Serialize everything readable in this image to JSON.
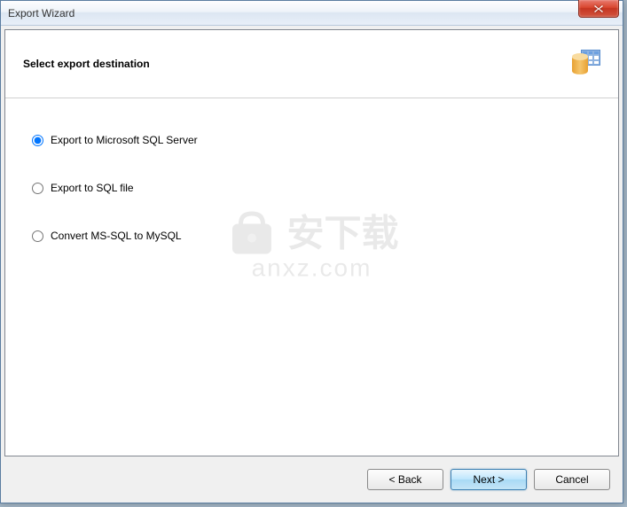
{
  "window": {
    "title": "Export Wizard"
  },
  "header": {
    "title": "Select export destination"
  },
  "options": [
    {
      "label": "Export to Microsoft SQL Server",
      "selected": true
    },
    {
      "label": "Export to SQL file",
      "selected": false
    },
    {
      "label": "Convert MS-SQL to MySQL",
      "selected": false
    }
  ],
  "buttons": {
    "back": "< Back",
    "next": "Next >",
    "cancel": "Cancel"
  },
  "watermark": {
    "text_cn": "安下载",
    "url": "anxz.com"
  }
}
